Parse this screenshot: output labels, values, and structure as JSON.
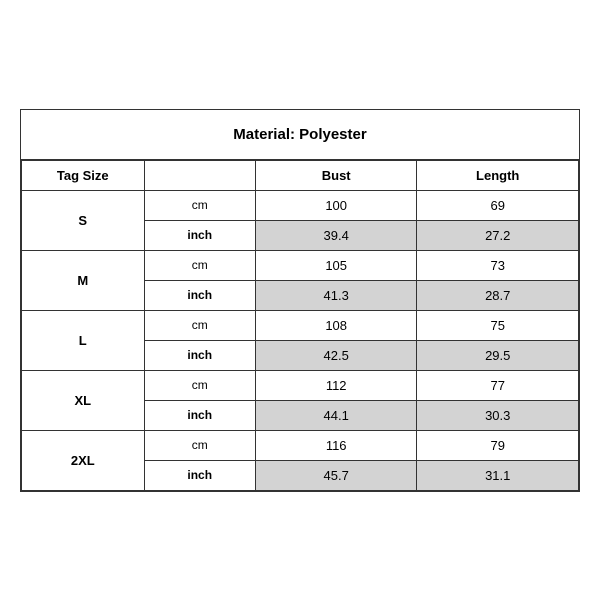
{
  "title": "Material: Polyester",
  "headers": {
    "tag_size": "Tag Size",
    "bust": "Bust",
    "length": "Length"
  },
  "sizes": [
    {
      "tag": "S",
      "cm": {
        "bust": "100",
        "length": "69"
      },
      "inch": {
        "bust": "39.4",
        "length": "27.2"
      }
    },
    {
      "tag": "M",
      "cm": {
        "bust": "105",
        "length": "73"
      },
      "inch": {
        "bust": "41.3",
        "length": "28.7"
      }
    },
    {
      "tag": "L",
      "cm": {
        "bust": "108",
        "length": "75"
      },
      "inch": {
        "bust": "42.5",
        "length": "29.5"
      }
    },
    {
      "tag": "XL",
      "cm": {
        "bust": "112",
        "length": "77"
      },
      "inch": {
        "bust": "44.1",
        "length": "30.3"
      }
    },
    {
      "tag": "2XL",
      "cm": {
        "bust": "116",
        "length": "79"
      },
      "inch": {
        "bust": "45.7",
        "length": "31.1"
      }
    }
  ],
  "units": {
    "cm": "cm",
    "inch": "inch"
  }
}
